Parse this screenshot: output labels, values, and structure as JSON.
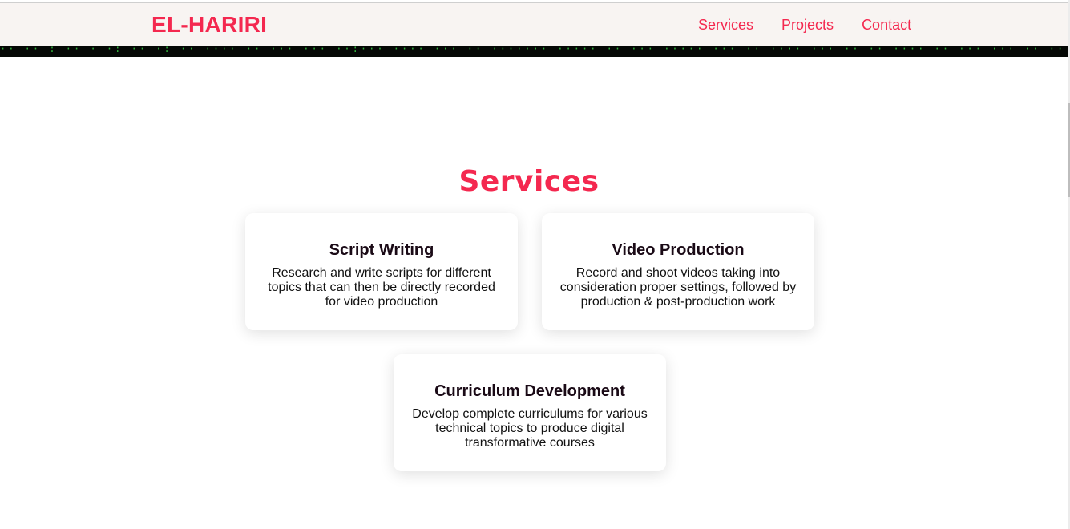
{
  "header": {
    "brand": "EL-HARIRI",
    "nav": [
      {
        "label": "Services"
      },
      {
        "label": "Projects"
      },
      {
        "label": "Contact"
      }
    ]
  },
  "services": {
    "title": "Services",
    "cards": [
      {
        "title": "Script Writing",
        "description": "Research and write scripts for different topics that can then be directly recorded for video production"
      },
      {
        "title": "Video Production",
        "description": "Record and shoot videos taking into consideration proper settings, followed by production & post-production work"
      },
      {
        "title": "Curriculum Development",
        "description": "Develop complete curriculums for various technical topics to produce digital transformative courses"
      }
    ]
  },
  "colors": {
    "accent": "#f4284f",
    "navbar_bg": "#f8f4f2",
    "hero_bg": "#050805",
    "hero_code": "#3cdc4a"
  }
}
